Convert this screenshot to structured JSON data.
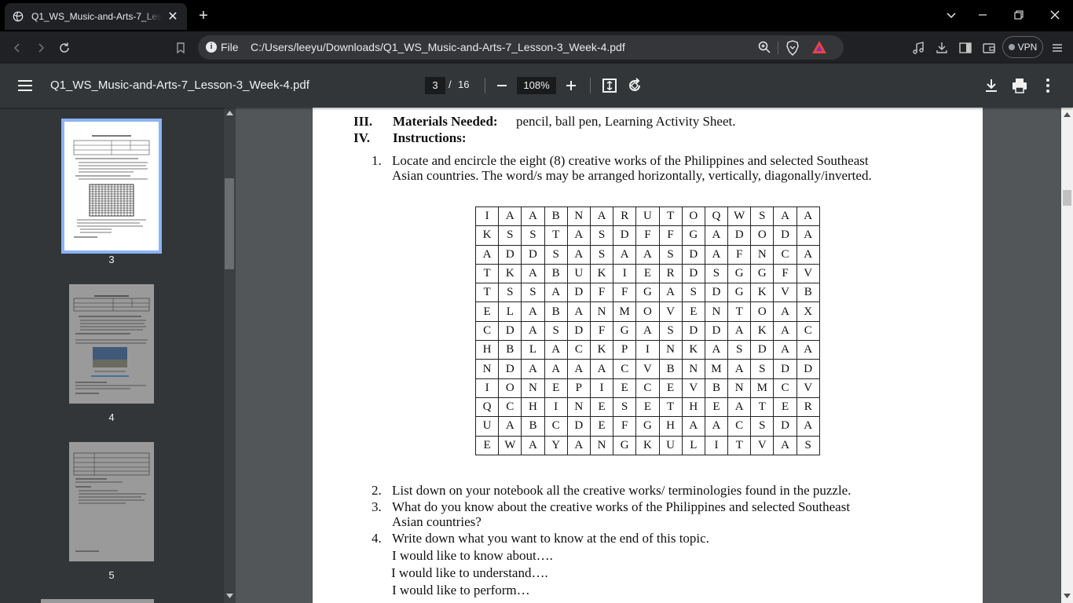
{
  "browser": {
    "tab_title": "Q1_WS_Music-and-Arts-7_Lesson-3_Week-4.pdf",
    "url_scheme": "File",
    "url": "C:/Users/leeyu/Downloads/Q1_WS_Music-and-Arts-7_Lesson-3_Week-4.pdf",
    "vpn_label": "VPN"
  },
  "viewer": {
    "title": "Q1_WS_Music-and-Arts-7_Lesson-3_Week-4.pdf",
    "current_page": "3",
    "page_sep": "/",
    "total_pages": "16",
    "zoom": "108%"
  },
  "thumbnails": [
    {
      "label": "3",
      "selected": true
    },
    {
      "label": "4",
      "selected": false
    },
    {
      "label": "5",
      "selected": false
    }
  ],
  "page": {
    "sections": [
      {
        "roman": "III.",
        "heading": "Materials Needed:",
        "text": "pencil, ball pen, Learning Activity Sheet."
      },
      {
        "roman": "IV.",
        "heading": "Instructions:",
        "text": ""
      }
    ],
    "items": [
      {
        "num": "1.",
        "lines": [
          "Locate and encircle the eight (8) creative works of the Philippines and selected Southeast",
          "Asian countries. The word/s may be arranged horizontally, vertically, diagonally/inverted."
        ]
      },
      {
        "num": "2.",
        "lines": [
          "List down on your notebook all the creative works/ terminologies found in the puzzle."
        ]
      },
      {
        "num": "3.",
        "lines": [
          "What do you know about the creative works of the Philippines and selected Southeast",
          "Asian countries?"
        ]
      },
      {
        "num": "4.",
        "lines": [
          "Write down what you want to know at the end of this topic.",
          "I would like to know about….",
          "I would like to understand….",
          "I would like to perform…"
        ]
      }
    ],
    "puzzle": [
      [
        "I",
        "A",
        "A",
        "B",
        "N",
        "A",
        "R",
        "U",
        "T",
        "O",
        "Q",
        "W",
        "S",
        "A",
        "A"
      ],
      [
        "K",
        "S",
        "S",
        "T",
        "A",
        "S",
        "D",
        "F",
        "F",
        "G",
        "A",
        "D",
        "O",
        "D",
        "A"
      ],
      [
        "A",
        "D",
        "D",
        "S",
        "A",
        "S",
        "A",
        "A",
        "S",
        "D",
        "A",
        "F",
        "N",
        "C",
        "A"
      ],
      [
        "T",
        "K",
        "A",
        "B",
        "U",
        "K",
        "I",
        "E",
        "R",
        "D",
        "S",
        "G",
        "G",
        "F",
        "V"
      ],
      [
        "T",
        "S",
        "S",
        "A",
        "D",
        "F",
        "F",
        "G",
        "A",
        "S",
        "D",
        "G",
        "K",
        "V",
        "B"
      ],
      [
        "E",
        "L",
        "A",
        "B",
        "A",
        "N",
        "M",
        "O",
        "V",
        "E",
        "N",
        "T",
        "O",
        "A",
        "X"
      ],
      [
        "C",
        "D",
        "A",
        "S",
        "D",
        "F",
        "G",
        "A",
        "S",
        "D",
        "D",
        "A",
        "K",
        "A",
        "C"
      ],
      [
        "H",
        "B",
        "L",
        "A",
        "C",
        "K",
        "P",
        "I",
        "N",
        "K",
        "A",
        "S",
        "D",
        "A",
        "A"
      ],
      [
        "N",
        "D",
        "A",
        "A",
        "A",
        "A",
        "C",
        "V",
        "B",
        "N",
        "M",
        "A",
        "S",
        "D",
        "D"
      ],
      [
        "I",
        "O",
        "N",
        "E",
        "P",
        "I",
        "E",
        "C",
        "E",
        "V",
        "B",
        "N",
        "M",
        "C",
        "V"
      ],
      [
        "Q",
        "C",
        "H",
        "I",
        "N",
        "E",
        "S",
        "E",
        "T",
        "H",
        "E",
        "A",
        "T",
        "E",
        "R"
      ],
      [
        "U",
        "A",
        "B",
        "C",
        "D",
        "E",
        "F",
        "G",
        "H",
        "A",
        "A",
        "C",
        "S",
        "D",
        "A"
      ],
      [
        "E",
        "W",
        "A",
        "Y",
        "A",
        "N",
        "G",
        "K",
        "U",
        "L",
        "I",
        "T",
        "V",
        "A",
        "S"
      ]
    ]
  },
  "colors": {
    "accent": "#8ab4f8",
    "toolbar": "#323639",
    "page_bg": "#525659"
  }
}
